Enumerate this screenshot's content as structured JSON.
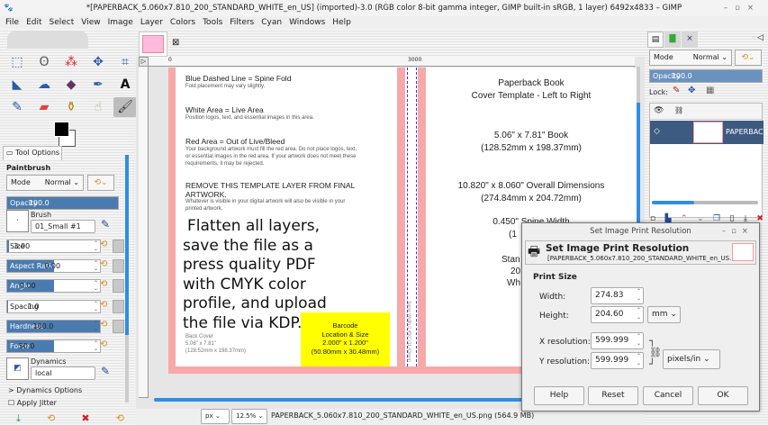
{
  "window": {
    "title": "*[PAPERBACK_5.060x7.810_200_STANDARD_WHITE_en_US] (imported)-3.0 (RGB color 8-bit gamma integer, GIMP built-in sRGB, 1 layer) 6492x4833 – GIMP"
  },
  "menu": [
    "File",
    "Edit",
    "Select",
    "View",
    "Image",
    "Layer",
    "Colors",
    "Tools",
    "Filters",
    "Cyan",
    "Windows",
    "Help"
  ],
  "tool_options": {
    "tab": "Tool Options",
    "tool": "Paintbrush",
    "mode_label": "Mode",
    "mode_value": "Normal",
    "opacity_label": "Opacity",
    "opacity": "100.0",
    "brush_label": "Brush",
    "brush": "01_Small #1",
    "sliders": [
      {
        "label": "Size",
        "value": "3.00",
        "fill": 0.02
      },
      {
        "label": "Aspect Ratio",
        "value": "0.00",
        "fill": 0.5
      },
      {
        "label": "Angle",
        "value": "0.00",
        "fill": 0.5
      },
      {
        "label": "Spacing",
        "value": "1.0",
        "fill": 0.01
      },
      {
        "label": "Hardness",
        "value": "100.0",
        "fill": 1.0
      },
      {
        "label": "Force",
        "value": "50.0",
        "fill": 0.5
      }
    ],
    "dynamics_label": "Dynamics",
    "dynamics": "local",
    "dynamics_options": "Dynamics Options",
    "apply_jitter": "Apply Jitter"
  },
  "canvas": {
    "left": {
      "h1": "Blue Dashed Line = Spine Fold",
      "p1": "Fold placement may vary slightly.",
      "h2": "White Area = Live Area",
      "p2": "Position logos, text, and essential images in this area.",
      "h3": "Red Area = Out of Live/Bleed",
      "p3a": "Your background artwork must fill the red area. Do not place logos, text,",
      "p3b": "or essential images in the red area. If your artwork does not meet these",
      "p3c": "requirements, it may be rejected.",
      "h4a": "REMOVE THIS TEMPLATE LAYER FROM FINAL",
      "h4b": "ARTWORK.",
      "p4a": "Whatever is visible in your digital artwork will also be visible in your",
      "p4b": "printed artwork.",
      "note": [
        "Flatten all layers,",
        "save the file as a",
        "press quality PDF",
        "with CMYK color",
        "profile, and upload",
        "the file via KDP."
      ],
      "back1": "Back Cover",
      "back2": "5.06\" x 7.81\"",
      "back3": "(128.52mm x 198.37mm)",
      "barcode": [
        "Barcode",
        "Location & Size",
        "2.000\" x 1.200\"",
        "(50.80mm x 30.48mm)"
      ]
    },
    "spine": "Spine Width 0.450\" (11.43mm)",
    "right": {
      "title": "Paperback Book",
      "subtitle": "Cover Template - Left to Right",
      "size": "5.06\" x 7.81\" Book",
      "size_mm": "(128.52mm x 198.37mm)",
      "overall": "10.820\" x 8.060\" Overall Dimensions",
      "overall_mm": "(274.84mm x 204.72mm)",
      "spine": "0.450\" Spine Width",
      "spine_mm": "(1",
      "paper": "Stan",
      "pages": "20",
      "color": "Wh"
    },
    "ruler_marks": [
      "0",
      "3000"
    ]
  },
  "status": {
    "unit": "px",
    "zoom": "12.5%",
    "file": "PAPERBACK_5.060x7.810_200_STANDARD_WHITE_en_US.png (564.9 MB)"
  },
  "layers": {
    "mode_label": "Mode",
    "mode": "Normal",
    "opacity_label": "Opacity",
    "opacity": "100.0",
    "lock": "Lock:",
    "layer_name": "PAPERBACK",
    "progress": 0.4
  },
  "dialog": {
    "title": "Set Image Print Resolution",
    "heading": "Set Image Print Resolution",
    "subtitle": "[PAPERBACK_5.060x7.810_200_STANDARD_WHITE_en_US...",
    "section": "Print Size",
    "width_label": "Width:",
    "width": "274.83",
    "height_label": "Height:",
    "height": "204.60",
    "size_unit": "mm",
    "xres_label": "X resolution:",
    "xres": "599.999",
    "yres_label": "Y resolution:",
    "yres": "599.999",
    "res_unit": "pixels/in",
    "help": "Help",
    "reset": "Reset",
    "cancel": "Cancel",
    "ok": "OK"
  }
}
